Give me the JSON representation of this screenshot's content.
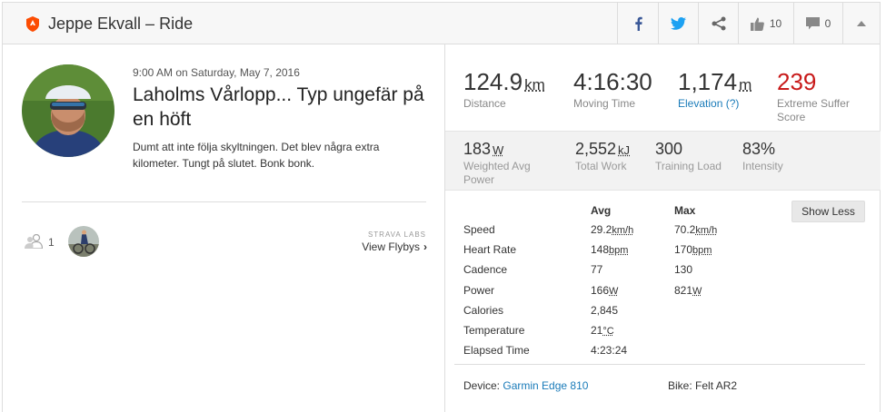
{
  "header": {
    "title": "Jeppe Ekvall – Ride",
    "kudos_count": "10",
    "comment_count": "0",
    "brand_color": "#fc4c02",
    "facebook_color": "#3b5998",
    "twitter_color": "#1da1f2"
  },
  "activity": {
    "date": "9:00 AM on Saturday, May 7, 2016",
    "title": "Laholms Vårlopp... Typ ungefär på en höft",
    "description": "Dumt att inte följa skyltningen. Det blev några extra kilometer. Tungt på slutet. Bonk bonk.",
    "athlete_count": "1",
    "labs_label": "STRAVA LABS",
    "flybys_label": "View Flybys"
  },
  "primary_stats": [
    {
      "value": "124.9",
      "unit": "km",
      "label": "Distance"
    },
    {
      "value": "4:16:30",
      "unit": "",
      "label": "Moving Time"
    },
    {
      "value": "1,174",
      "unit": "m",
      "label": "Elevation (?)"
    },
    {
      "value": "239",
      "unit": "",
      "label": "Extreme Suffer Score"
    }
  ],
  "secondary_stats": [
    {
      "value": "183",
      "unit": "W",
      "label": "Weighted Avg Power"
    },
    {
      "value": "2,552",
      "unit": "kJ",
      "label": "Total Work"
    },
    {
      "value": "300",
      "unit": "",
      "label": "Training Load"
    },
    {
      "value": "83%",
      "unit": "",
      "label": "Intensity"
    }
  ],
  "table": {
    "avg_header": "Avg",
    "max_header": "Max",
    "show_less": "Show Less",
    "rows": [
      {
        "label": "Speed",
        "avg": "29.2",
        "avg_unit": "km/h",
        "max": "70.2",
        "max_unit": "km/h"
      },
      {
        "label": "Heart Rate",
        "avg": "148",
        "avg_unit": "bpm",
        "max": "170",
        "max_unit": "bpm"
      },
      {
        "label": "Cadence",
        "avg": "77",
        "avg_unit": "",
        "max": "130",
        "max_unit": ""
      },
      {
        "label": "Power",
        "avg": "166",
        "avg_unit": "W",
        "max": "821",
        "max_unit": "W"
      },
      {
        "label": "Calories",
        "avg": "2,845",
        "avg_unit": "",
        "max": "",
        "max_unit": ""
      },
      {
        "label": "Temperature",
        "avg": "21",
        "avg_unit": "°C",
        "max": "",
        "max_unit": ""
      },
      {
        "label": "Elapsed Time",
        "avg": "4:23:24",
        "avg_unit": "",
        "max": "",
        "max_unit": ""
      }
    ]
  },
  "gear": {
    "device_label": "Device:",
    "device_name": "Garmin Edge 810",
    "bike_label": "Bike:",
    "bike_name": "Felt AR2"
  }
}
